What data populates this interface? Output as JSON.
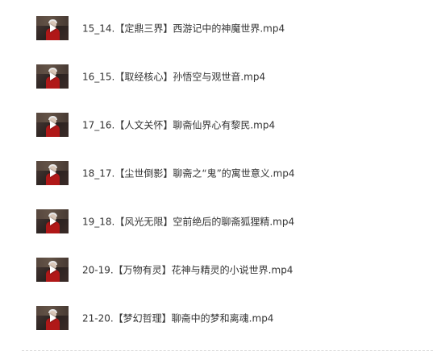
{
  "files": [
    {
      "name": "15_14.【定鼎三界】西游记中的神魔世界.mp4",
      "thumbnail_icon": "video-play-icon"
    },
    {
      "name": "16_15.【取经核心】孙悟空与观世音.mp4",
      "thumbnail_icon": "video-play-icon"
    },
    {
      "name": "17_16.【人文关怀】聊斋仙界心有黎民.mp4",
      "thumbnail_icon": "video-play-icon"
    },
    {
      "name": "18_17.【尘世倒影】聊斋之“鬼”的寓世意义.mp4",
      "thumbnail_icon": "video-play-icon"
    },
    {
      "name": "19_18.【风光无限】空前绝后的聊斋狐狸精.mp4",
      "thumbnail_icon": "video-play-icon"
    },
    {
      "name": "20-19.【万物有灵】花神与精灵的小说世界.mp4",
      "thumbnail_icon": "video-play-icon"
    },
    {
      "name": "21-20.【梦幻哲理】聊斋中的梦和离魂.mp4",
      "thumbnail_icon": "video-play-icon"
    }
  ],
  "colors": {
    "text": "#333333",
    "thumbnail_shirt": "#b01818",
    "divider": "#dcdcdc"
  }
}
